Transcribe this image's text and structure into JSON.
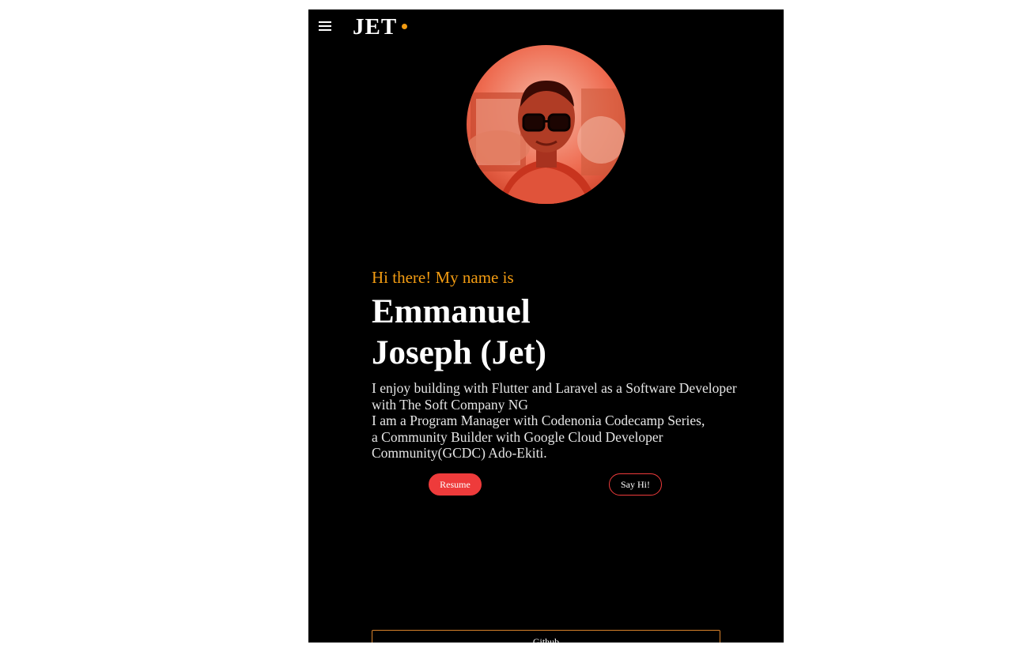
{
  "header": {
    "menu_icon": "hamburger-menu-icon",
    "logo_text": "JET",
    "logo_dot_color": "#f39c12"
  },
  "hero": {
    "avatar_alt": "profile-photo",
    "greeting": "Hi there! My name is",
    "greeting_color": "#f39c12",
    "name_line1": "Emmanuel",
    "name_line2": "Joseph (Jet)",
    "bio_lines": [
      "I enjoy building with Flutter and Laravel as a Software Developer",
      "with The Soft Company NG",
      "I am a Program Manager with Codenonia Codecamp Series,",
      "a Community Builder with Google Cloud Developer",
      "Community(GCDC) Ado-Ekiti."
    ]
  },
  "actions": {
    "resume_label": "Resume",
    "say_hi_label": "Say Hi!",
    "accent_color": "#ee3b3b"
  },
  "links": {
    "github_label": "Github",
    "border_color": "#d9822b"
  }
}
